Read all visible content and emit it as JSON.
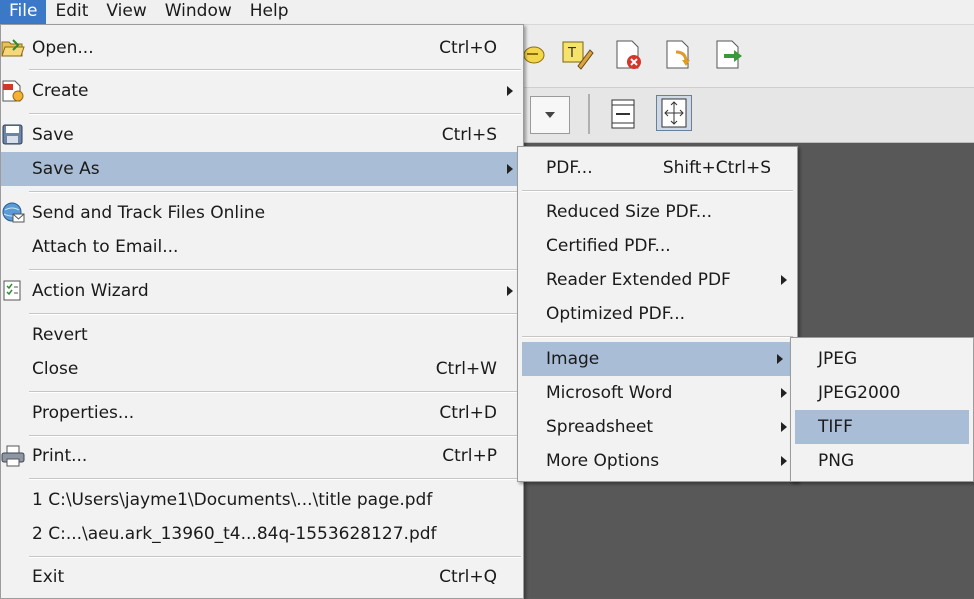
{
  "menubar": {
    "items": [
      "File",
      "Edit",
      "View",
      "Window",
      "Help"
    ]
  },
  "toolbar": {
    "icons": [
      "comment-icon",
      "sticky-note-icon",
      "delete-page-icon",
      "replace-page-icon",
      "extract-page-icon"
    ],
    "view_icons": [
      "fit-width-icon",
      "fit-page-icon"
    ]
  },
  "file_menu": {
    "open": {
      "label": "Open...",
      "shortcut": "Ctrl+O"
    },
    "create": {
      "label": "Create"
    },
    "save": {
      "label": "Save",
      "shortcut": "Ctrl+S"
    },
    "save_as": {
      "label": "Save As"
    },
    "send_track": {
      "label": "Send and Track Files Online"
    },
    "attach_email": {
      "label": "Attach to Email..."
    },
    "action_wizard": {
      "label": "Action Wizard"
    },
    "revert": {
      "label": "Revert"
    },
    "close": {
      "label": "Close",
      "shortcut": "Ctrl+W"
    },
    "properties": {
      "label": "Properties...",
      "shortcut": "Ctrl+D"
    },
    "print": {
      "label": "Print...",
      "shortcut": "Ctrl+P"
    },
    "recent1": {
      "label": "1 C:\\Users\\jayme1\\Documents\\...\\title page.pdf"
    },
    "recent2": {
      "label": "2 C:...\\aeu.ark_13960_t4...84q-1553628127.pdf"
    },
    "exit": {
      "label": "Exit",
      "shortcut": "Ctrl+Q"
    }
  },
  "save_as_menu": {
    "pdf": {
      "label": "PDF...",
      "shortcut": "Shift+Ctrl+S"
    },
    "reduced": {
      "label": "Reduced Size PDF..."
    },
    "certified": {
      "label": "Certified PDF..."
    },
    "reader_extended": {
      "label": "Reader Extended PDF"
    },
    "optimized": {
      "label": "Optimized PDF..."
    },
    "image": {
      "label": "Image"
    },
    "word": {
      "label": "Microsoft Word"
    },
    "spreadsheet": {
      "label": "Spreadsheet"
    },
    "more": {
      "label": "More Options"
    }
  },
  "image_menu": {
    "jpeg": {
      "label": "JPEG"
    },
    "jpeg2000": {
      "label": "JPEG2000"
    },
    "tiff": {
      "label": "TIFF"
    },
    "png": {
      "label": "PNG"
    }
  },
  "colors": {
    "highlight": "#a9bed6",
    "menubar_active": "#3c78c8",
    "menu_bg": "#f2f2f2",
    "workspace": "#585858"
  }
}
